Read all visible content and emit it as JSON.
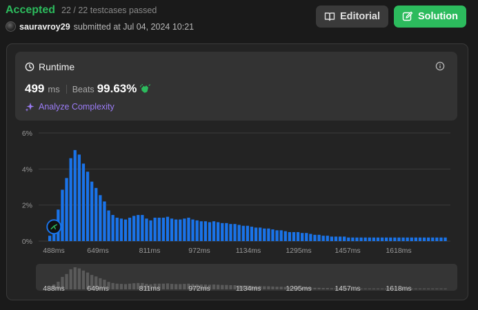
{
  "submission": {
    "status": "Accepted",
    "testcases": "22 / 22 testcases passed",
    "username": "sauravroy29",
    "submitted_text": "submitted at Jul 04, 2024 10:21"
  },
  "buttons": {
    "editorial": "Editorial",
    "solution": "Solution"
  },
  "runtime_card": {
    "title": "Runtime",
    "value": "499",
    "unit": "ms",
    "beats_label": "Beats",
    "beats_value": "99.63%",
    "analyze_label": "Analyze Complexity"
  },
  "colors": {
    "accepted": "#2cbb5d",
    "bar": "#1a73e8",
    "navigator_bar": "#5a5a5a",
    "analyze": "#9b7cf6",
    "clap": "#2cbb5d"
  },
  "chart_data": {
    "type": "bar",
    "x_tick_labels": [
      "488ms",
      "649ms",
      "811ms",
      "972ms",
      "1134ms",
      "1295ms",
      "1457ms",
      "1618ms"
    ],
    "y_tick_labels": [
      "0%",
      "2%",
      "4%",
      "6%"
    ],
    "ylim": [
      0,
      6
    ],
    "grid": true,
    "values": [
      0.3,
      1.1,
      1.75,
      2.85,
      3.5,
      4.6,
      5.05,
      4.8,
      4.3,
      3.85,
      3.3,
      2.95,
      2.55,
      2.2,
      1.7,
      1.45,
      1.3,
      1.25,
      1.2,
      1.3,
      1.4,
      1.45,
      1.45,
      1.25,
      1.15,
      1.3,
      1.3,
      1.3,
      1.35,
      1.25,
      1.2,
      1.2,
      1.25,
      1.3,
      1.2,
      1.15,
      1.1,
      1.1,
      1.05,
      1.1,
      1.05,
      1.0,
      1.0,
      0.95,
      0.95,
      0.9,
      0.85,
      0.85,
      0.8,
      0.75,
      0.75,
      0.7,
      0.7,
      0.65,
      0.6,
      0.6,
      0.55,
      0.5,
      0.5,
      0.5,
      0.45,
      0.45,
      0.4,
      0.35,
      0.35,
      0.3,
      0.3,
      0.25,
      0.25,
      0.25,
      0.25,
      0.2,
      0.2,
      0.2,
      0.2,
      0.2,
      0.2,
      0.2,
      0.2,
      0.2,
      0.2,
      0.2,
      0.2,
      0.2,
      0.2,
      0.2,
      0.2,
      0.2,
      0.2,
      0.2,
      0.2,
      0.2,
      0.2,
      0.2,
      0.2
    ],
    "highlighted_index": 1
  }
}
